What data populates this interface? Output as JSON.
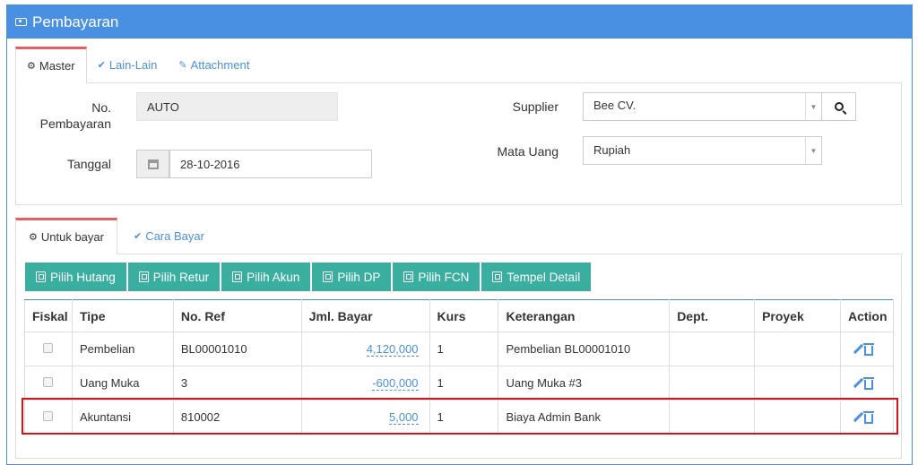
{
  "header": {
    "title": "Pembayaran",
    "icon": "money-icon"
  },
  "master_tabs": [
    {
      "label": "Master",
      "icon": "gears-icon"
    },
    {
      "label": "Lain-Lain",
      "icon": "check-circle-icon"
    },
    {
      "label": "Attachment",
      "icon": "paperclip-icon"
    }
  ],
  "form": {
    "no_label_1": "No.",
    "no_label_2": "Pembayaran",
    "no_value": "AUTO",
    "tanggal_label": "Tanggal",
    "tanggal_value": "28-10-2016",
    "supplier_label": "Supplier",
    "supplier_value": "Bee CV.",
    "mata_uang_label": "Mata Uang",
    "mata_uang_value": "Rupiah"
  },
  "detail_tabs": [
    {
      "label": "Untuk bayar",
      "icon": "gears-icon"
    },
    {
      "label": "Cara Bayar",
      "icon": "check-circle-icon"
    }
  ],
  "buttons": [
    "Pilih Hutang",
    "Pilih Retur",
    "Pilih Akun",
    "Pilih DP",
    "Pilih FCN",
    "Tempel Detail"
  ],
  "table": {
    "headers": [
      "Fiskal",
      "Tipe",
      "No. Ref",
      "Jml. Bayar",
      "Kurs",
      "Keterangan",
      "Dept.",
      "Proyek",
      "Action"
    ],
    "rows": [
      {
        "tipe": "Pembelian",
        "no_ref": "BL00001010",
        "jml_bayar": "4,120,000",
        "kurs": "1",
        "keterangan": "Pembelian BL00001010",
        "dept": "",
        "proyek": ""
      },
      {
        "tipe": "Uang Muka",
        "no_ref": "3",
        "jml_bayar": "-600,000",
        "kurs": "1",
        "keterangan": "Uang Muka #3",
        "dept": "",
        "proyek": ""
      },
      {
        "tipe": "Akuntansi",
        "no_ref": "810002",
        "jml_bayar": "5,000",
        "kurs": "1",
        "keterangan": "Biaya Admin Bank",
        "dept": "",
        "proyek": ""
      }
    ]
  },
  "colors": {
    "accent": "#4a90e2",
    "button": "#3aafa0",
    "highlight": "#d0141c",
    "tab_active": "#e46060"
  }
}
